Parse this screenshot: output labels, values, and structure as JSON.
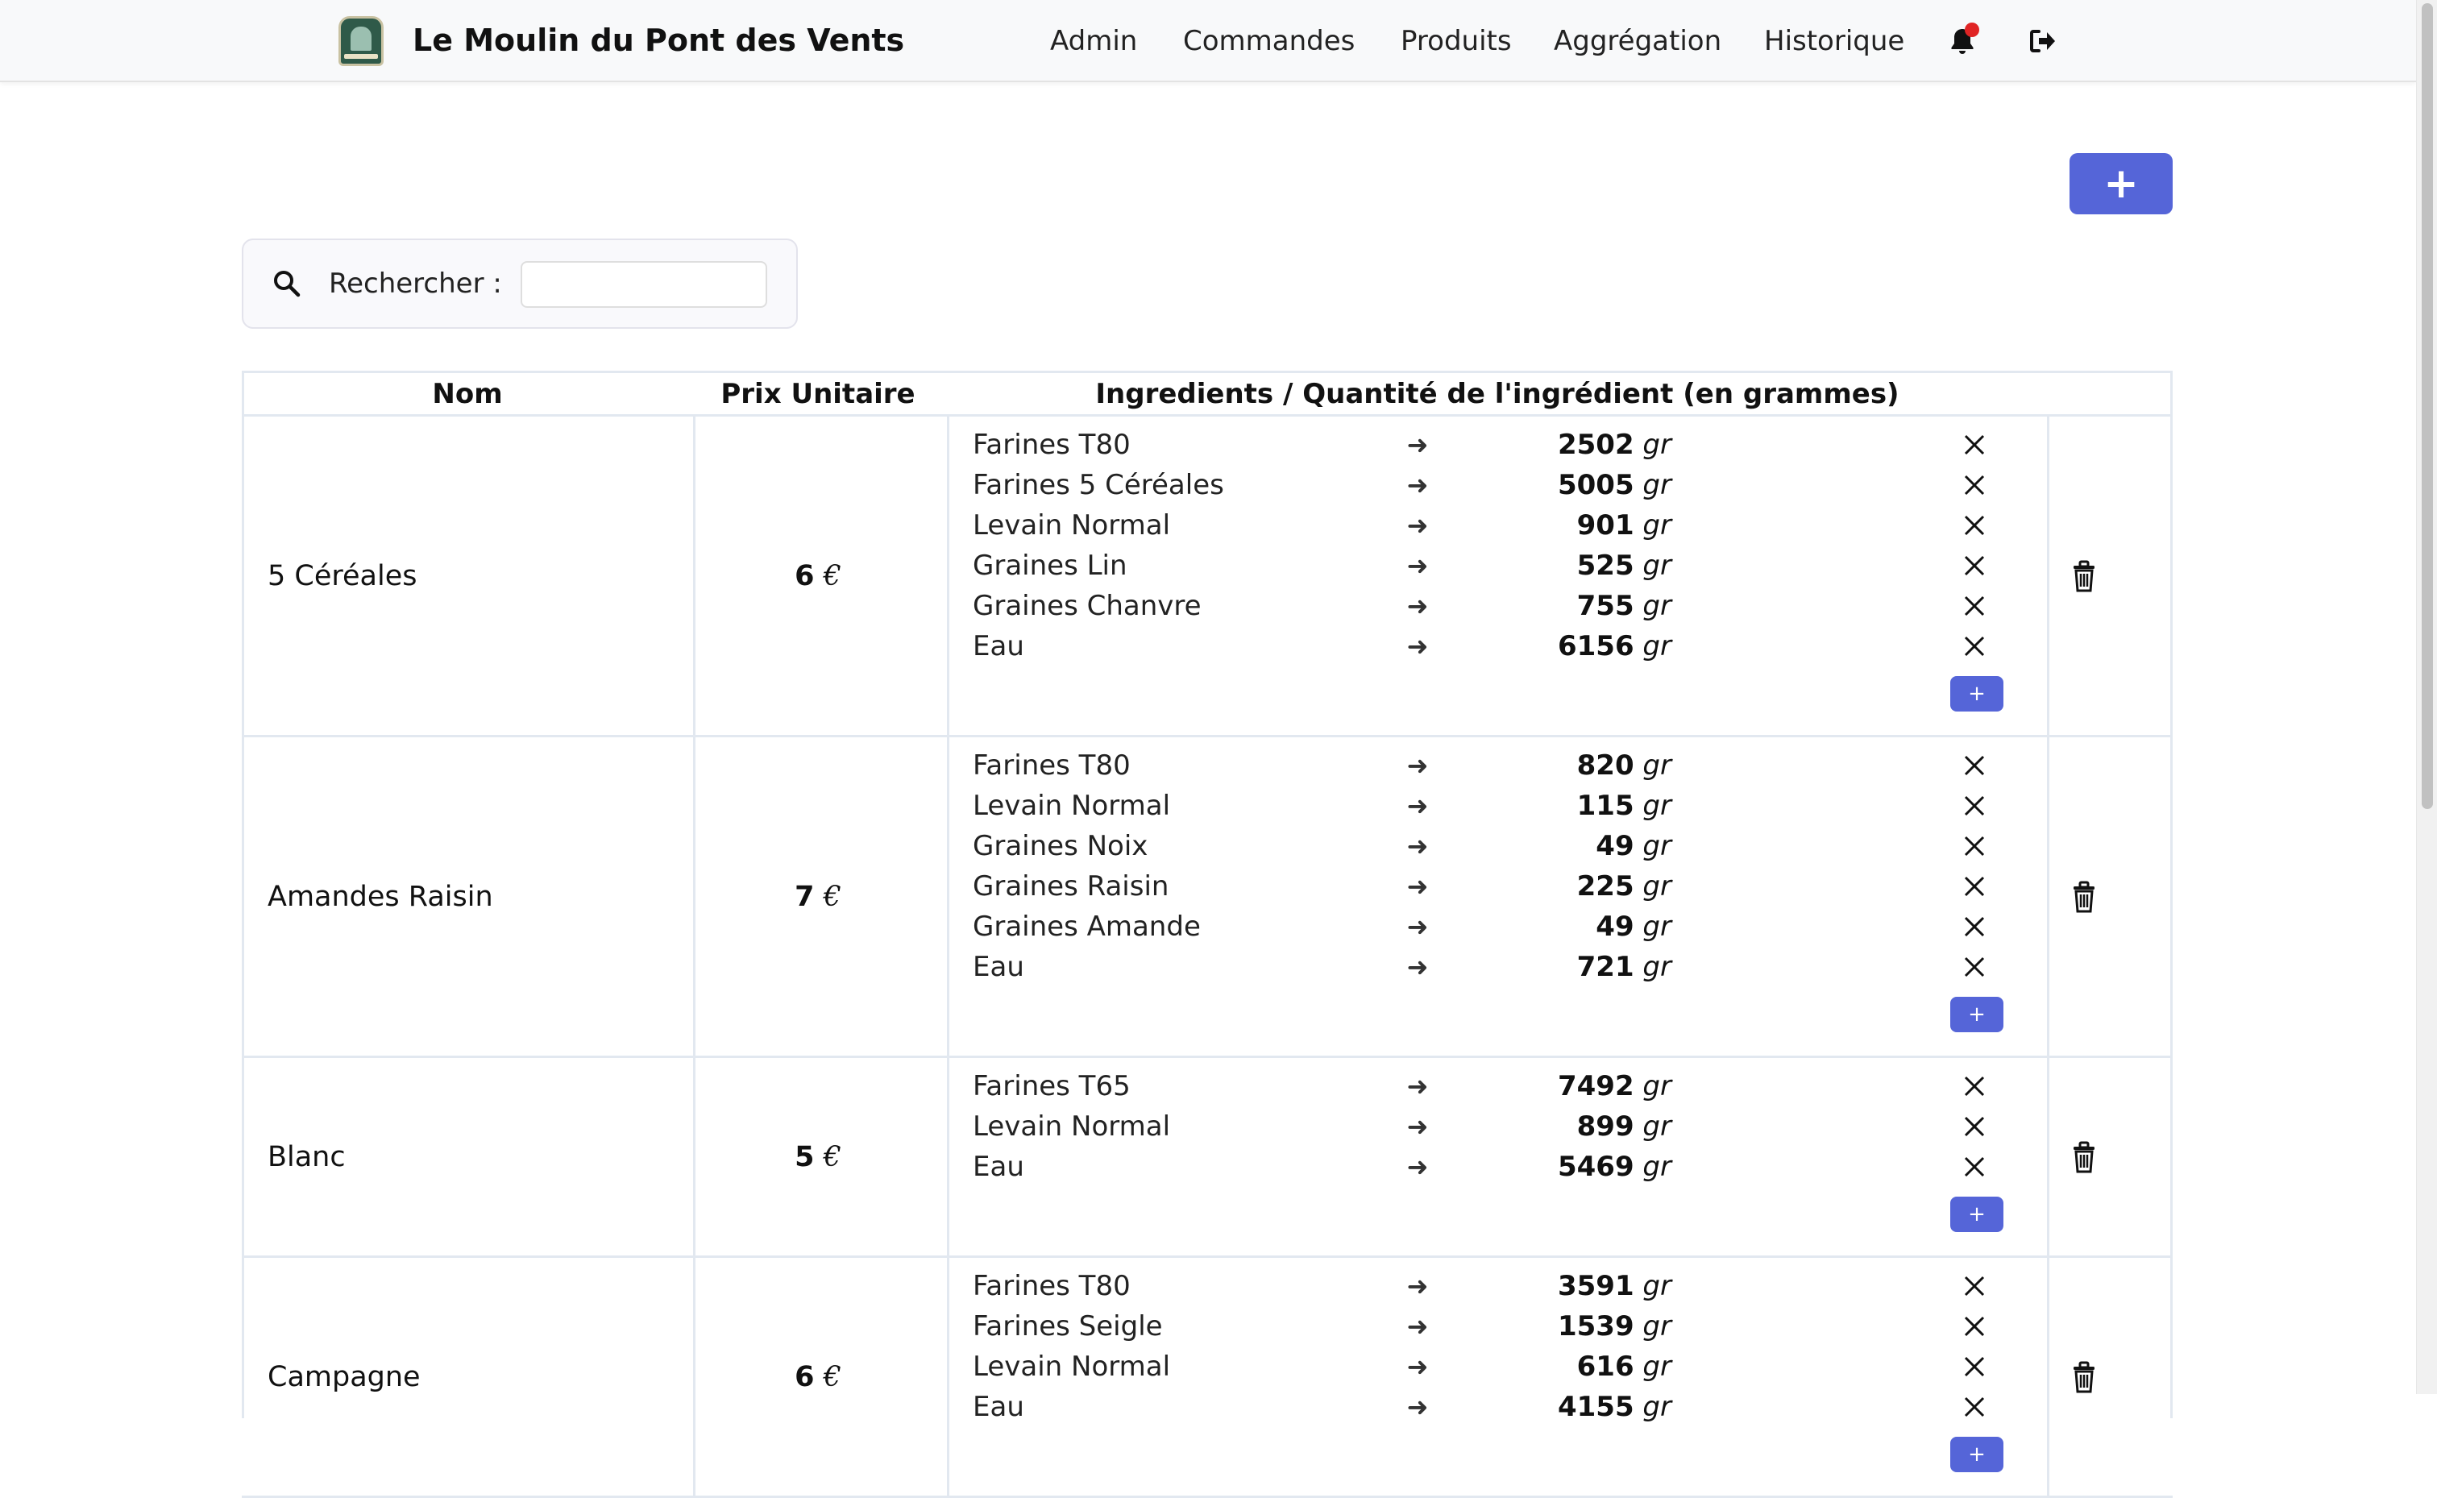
{
  "navbar": {
    "brand": "Le Moulin du Pont des Vents",
    "links": [
      "Admin",
      "Commandes",
      "Produits",
      "Aggrégation",
      "Historique"
    ],
    "icons": [
      "bell-icon",
      "logout-icon"
    ]
  },
  "actions": {
    "add_label": "+"
  },
  "search": {
    "label": "Rechercher :",
    "value": ""
  },
  "table": {
    "headers": [
      "Nom",
      "Prix Unitaire",
      "Ingredients / Quantité de l'ingrédient (en grammes)"
    ],
    "unit": "gr",
    "currency": "€",
    "add_ingredient_label": "+",
    "rows": [
      {
        "name": "5 Céréales",
        "price": "6",
        "ingredients": [
          {
            "name": "Farines T80",
            "qty": "2502"
          },
          {
            "name": "Farines 5 Céréales",
            "qty": "5005"
          },
          {
            "name": "Levain Normal",
            "qty": "901"
          },
          {
            "name": "Graines Lin",
            "qty": "525"
          },
          {
            "name": "Graines Chanvre",
            "qty": "755"
          },
          {
            "name": "Eau",
            "qty": "6156"
          }
        ]
      },
      {
        "name": "Amandes Raisin",
        "price": "7",
        "ingredients": [
          {
            "name": "Farines T80",
            "qty": "820"
          },
          {
            "name": "Levain Normal",
            "qty": "115"
          },
          {
            "name": "Graines Noix",
            "qty": "49"
          },
          {
            "name": "Graines Raisin",
            "qty": "225"
          },
          {
            "name": "Graines Amande",
            "qty": "49"
          },
          {
            "name": "Eau",
            "qty": "721"
          }
        ]
      },
      {
        "name": "Blanc",
        "price": "5",
        "ingredients": [
          {
            "name": "Farines T65",
            "qty": "7492"
          },
          {
            "name": "Levain Normal",
            "qty": "899"
          },
          {
            "name": "Eau",
            "qty": "5469"
          }
        ]
      },
      {
        "name": "Campagne",
        "price": "6",
        "ingredients": [
          {
            "name": "Farines T80",
            "qty": "3591"
          },
          {
            "name": "Farines Seigle",
            "qty": "1539"
          },
          {
            "name": "Levain Normal",
            "qty": "616"
          },
          {
            "name": "Eau",
            "qty": "4155"
          }
        ]
      }
    ]
  },
  "colors": {
    "accent": "#5565d8",
    "notification": "#e02424",
    "border": "#e2e8f0"
  }
}
